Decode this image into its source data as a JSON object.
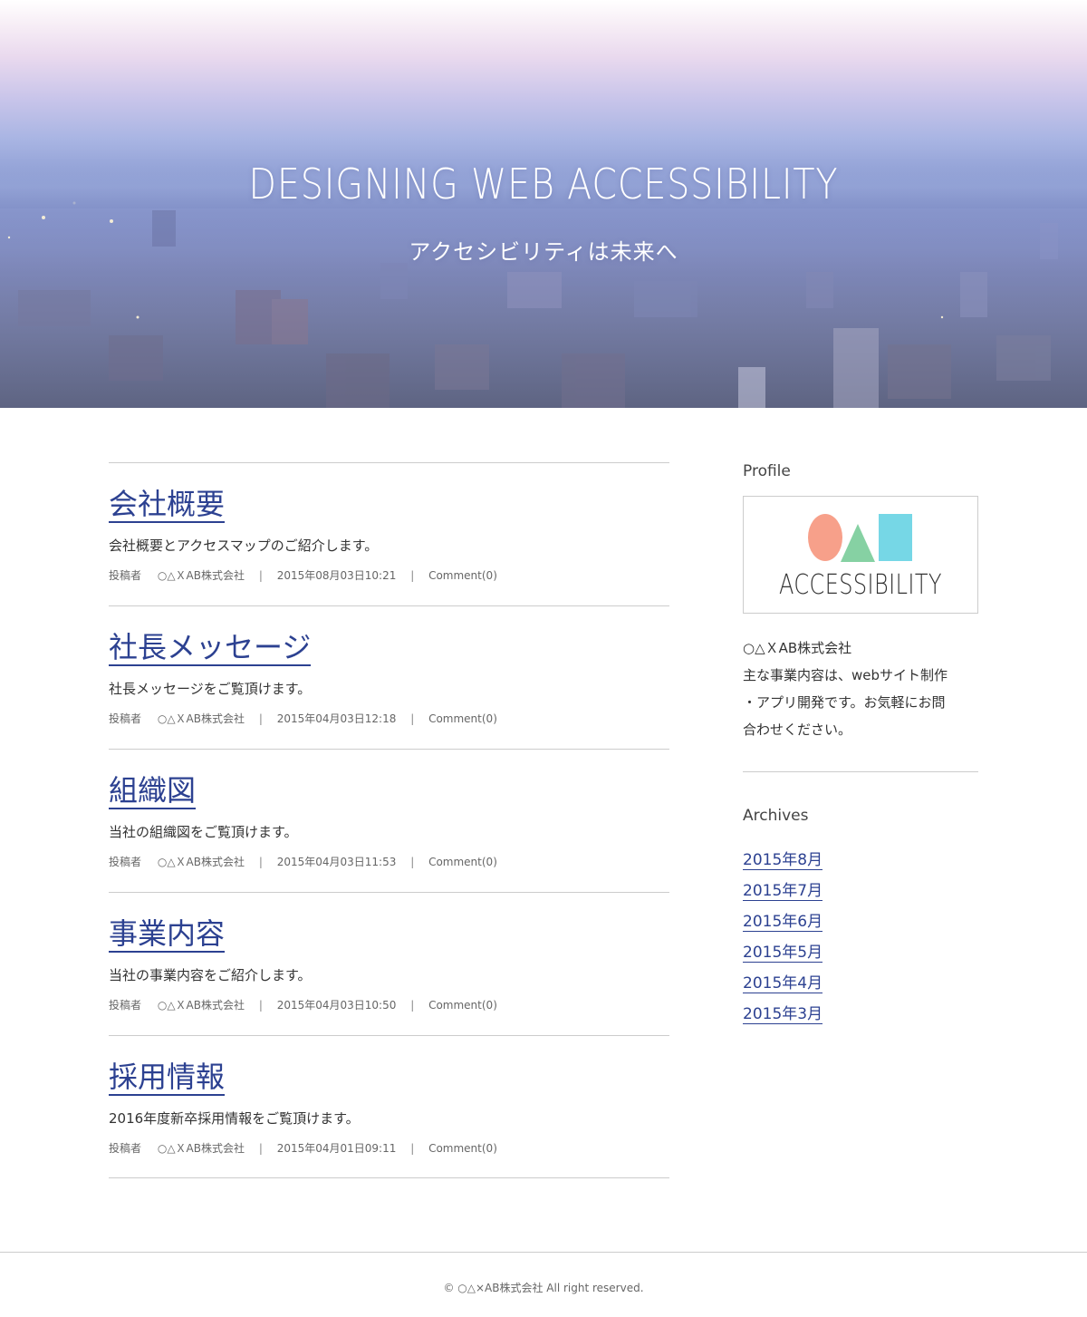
{
  "hero": {
    "title": "DESIGNING WEB ACCESSIBILITY",
    "subtitle": "アクセシビリティは未来へ"
  },
  "posts": [
    {
      "title": "会社概要",
      "excerpt": "会社概要とアクセスマップのご紹介します。",
      "author_label": "投稿者",
      "author": "○△ＸAB株式会社",
      "date": "2015年08月03日10:21",
      "comments": "Comment(0)"
    },
    {
      "title": "社長メッセージ",
      "excerpt": "社長メッセージをご覧頂けます。",
      "author_label": "投稿者",
      "author": "○△ＸAB株式会社",
      "date": "2015年04月03日12:18",
      "comments": "Comment(0)"
    },
    {
      "title": "組織図",
      "excerpt": "当社の組織図をご覧頂けます。",
      "author_label": "投稿者",
      "author": "○△ＸAB株式会社",
      "date": "2015年04月03日11:53",
      "comments": "Comment(0)"
    },
    {
      "title": "事業内容",
      "excerpt": "当社の事業内容をご紹介します。",
      "author_label": "投稿者",
      "author": "○△ＸAB株式会社",
      "date": "2015年04月03日10:50",
      "comments": "Comment(0)"
    },
    {
      "title": "採用情報",
      "excerpt": "2016年度新卒採用情報をご覧頂けます。",
      "author_label": "投稿者",
      "author": "○△ＸAB株式会社",
      "date": "2015年04月01日09:11",
      "comments": "Comment(0)"
    }
  ],
  "meta_separator": "|",
  "sidebar": {
    "profile_title": "Profile",
    "logo": {
      "text": "ACCESSIBILITY",
      "shapes": [
        "circle-shape",
        "triangle-shape",
        "square-shape"
      ],
      "colors": {
        "circle": "#f7a08a",
        "triangle": "#86d1a3",
        "square": "#76d7e6"
      }
    },
    "profile_lines": [
      "○△ＸAB株式会社",
      "主な事業内容は、webサイト制作",
      "・アプリ開発です。お気軽にお問",
      "合わせください。"
    ],
    "archives_title": "Archives",
    "archives": [
      "2015年8月",
      "2015年7月",
      "2015年6月",
      "2015年5月",
      "2015年4月",
      "2015年3月"
    ]
  },
  "footer": {
    "copyright": "© ○△×AB株式会社 All right reserved."
  },
  "colors": {
    "link": "#2c4191",
    "divider": "#cccccc",
    "text": "#333333"
  }
}
